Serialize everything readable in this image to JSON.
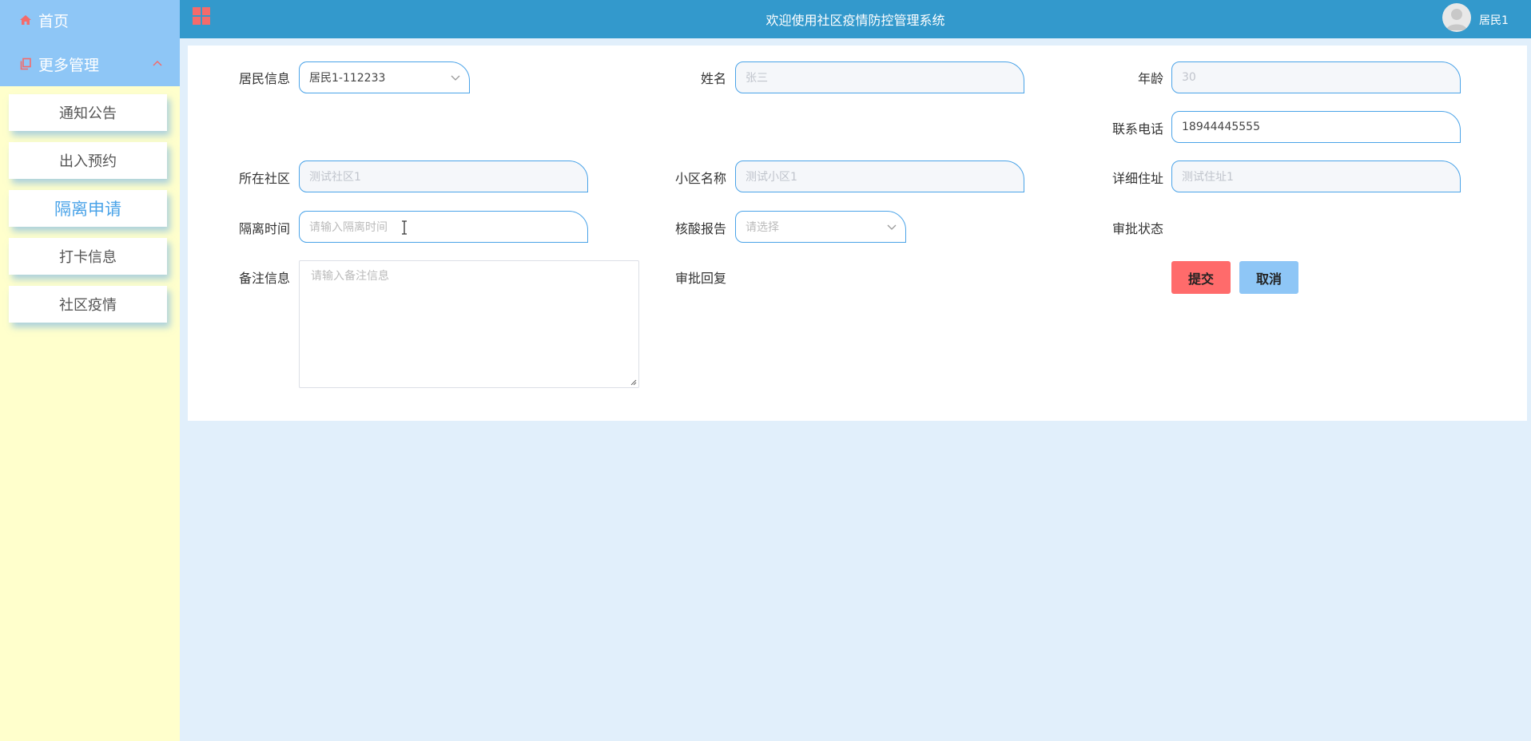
{
  "header": {
    "title": "欢迎使用社区疫情防控管理系统",
    "username": "居民1"
  },
  "sidebar": {
    "home_label": "首页",
    "more_label": "更多管理",
    "items": [
      {
        "label": "通知公告"
      },
      {
        "label": "出入预约"
      },
      {
        "label": "隔离申请",
        "active": true
      },
      {
        "label": "打卡信息"
      },
      {
        "label": "社区疫情"
      }
    ]
  },
  "form": {
    "resident_info": {
      "label": "居民信息",
      "value": "居民1-112233"
    },
    "name": {
      "label": "姓名",
      "value": "张三"
    },
    "age": {
      "label": "年龄",
      "value": "30"
    },
    "phone": {
      "label": "联系电话",
      "value": "18944445555"
    },
    "community": {
      "label": "所在社区",
      "value": "测试社区1"
    },
    "estate": {
      "label": "小区名称",
      "value": "测试小区1"
    },
    "address": {
      "label": "详细住址",
      "value": "测试住址1"
    },
    "isolation_time": {
      "label": "隔离时间",
      "placeholder": "请输入隔离时间"
    },
    "nucleic_report": {
      "label": "核酸报告",
      "placeholder": "请选择"
    },
    "approval_status": {
      "label": "审批状态"
    },
    "remark": {
      "label": "备注信息",
      "placeholder": "请输入备注信息"
    },
    "approval_reply": {
      "label": "审批回复"
    },
    "submit_label": "提交",
    "cancel_label": "取消"
  },
  "colors": {
    "header_bg": "#3399cc",
    "sidebar_bg": "#ffffcc",
    "sidebar_top_bg": "#8ec6f6",
    "page_bg": "#e1effb",
    "submit_bg": "#ff6b6b",
    "cancel_bg": "#8ec6f6",
    "accent": "#4aa3e8"
  },
  "icons": [
    "home-icon",
    "copy-icon",
    "chevron-up-icon",
    "grid-menu-icon",
    "user-avatar-icon",
    "chevron-down-icon",
    "text-cursor-icon",
    "resize-handle-icon"
  ]
}
